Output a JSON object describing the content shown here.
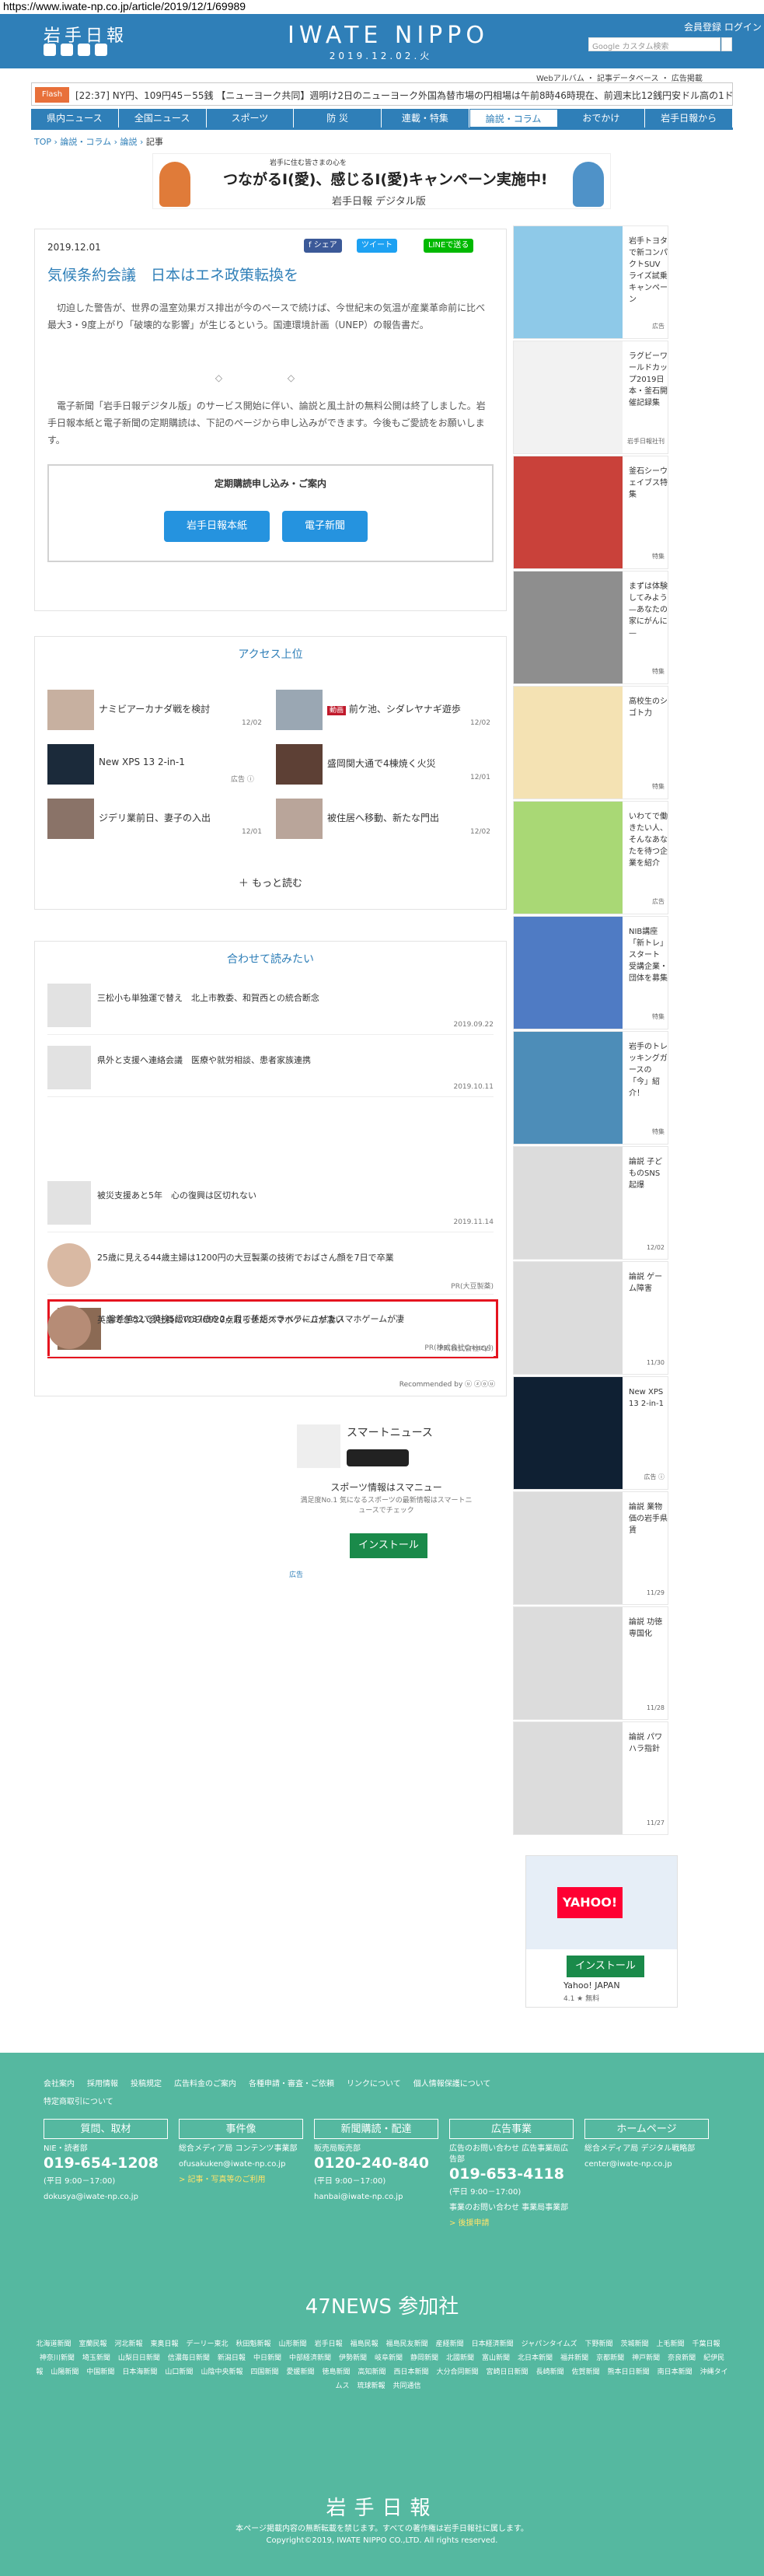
{
  "url": "https://www.iwate-np.co.jp/article/2019/12/1/69989",
  "header": {
    "logo": "岩手日報",
    "brand": "IWATE NIPPO",
    "date": "2019.12.02.火",
    "links": "会員登録 ログイン",
    "search_placeholder": "Google カスタム検索",
    "sub_links": "Webアルバム ・ 記事データベース ・ 広告掲載"
  },
  "flash": {
    "label": "Flash",
    "text": "[22:37] NY円、109円45－55銭 【ニューヨーク共同】週明け2日のニューヨーク外国為替市場の円相場は午前8時46時現在、前週末比12銭円安ドル高の1ドル"
  },
  "nav": [
    "県内ニュース",
    "全国ニュース",
    "スポーツ",
    "防 災",
    "連載・特集",
    "論説・コラム",
    "おでかけ",
    "岩手日報から"
  ],
  "breadcrumb": {
    "top": "TOP",
    "sep": " › ",
    "c1": "論説・コラム",
    "c2": "論説",
    "current": "記事"
  },
  "banner": {
    "t1": "岩手に住む皆さまの心を",
    "t2": "つながるⅠ(愛)、感じるⅠ(愛)キャンペーン実施中!",
    "t3": "岩手日報 デジタル版"
  },
  "article": {
    "date": "2019.12.01",
    "share_fb": "f シェア",
    "share_tw": "ツイート",
    "share_line": "LINEで送る",
    "title": "気候条約会議　日本はエネ政策転換を",
    "p1": "　切迫した警告が、世界の温室効果ガス排出が今のペースで続けば、今世紀末の気温が産業革命前に比べ最大3・9度上がり「破壊的な影響」が生じるという。国連環境計画（UNEP）の報告書だ。",
    "diamonds": "◇ ◇",
    "p2": "　電子新聞「岩手日報デジタル版」のサービス開始に伴い、論説と風土計の無料公開は終了しました。岩手日報本紙と電子新聞の定期購読は、下記のページから申し込みができます。今後もご愛読をお願いします。",
    "sub_title": "定期購読申し込み・ご案内",
    "btn_paper": "岩手日報本紙",
    "btn_digital": "電子新聞"
  },
  "ranking": {
    "title": "アクセス上位",
    "items": [
      {
        "title": "ナミビアーカナダ戦を検討",
        "date": "12/02"
      },
      {
        "title": "前ケ池、シダレヤナギ遊歩",
        "date": "12/02",
        "tag": "動画"
      },
      {
        "title": "New XPS 13 2-in-1",
        "date": "広告 ⓘ"
      },
      {
        "title": "盛岡関大通で4棟焼く火災",
        "date": "12/01"
      },
      {
        "title": "ジデリ業前日、妻子の入出",
        "date": "12/01"
      },
      {
        "title": "被住居へ移動、新たな門出",
        "date": "12/02"
      }
    ],
    "more": "＋ もっと読む"
  },
  "related": {
    "title": "合わせて読みたい",
    "items": [
      {
        "title": "三松小も単独運で替え　北上市教委、和賀西との統合断念",
        "date": "2019.09.22"
      },
      {
        "title": "県外と支援へ連絡会議　医療や就労相談、患者家族連携",
        "date": "2019.10.11"
      },
      {
        "title": "偏差値32で英検5級の37歳を2ヶ月で英語ペラペラにさせたスマホゲームが凄",
        "date": "PR(株式会社Creazy)"
      },
      {
        "title": "被災支援あと5年　心の復興は区切れない",
        "date": "2019.11.14"
      },
      {
        "title": "25歳に見える44歳主婦は1200円の大豆製薬の技術でおばさん顔を7日で卒業",
        "date": "PR(大豆製薬)"
      },
      {
        "title": "英語できない会社員にTOEIC920点取らせたスマホゲームが凄い",
        "date": "PR(株式会社IGS)"
      }
    ],
    "recommended": "Recommended by ⓤ ⓩⓞⓤ"
  },
  "ad_bottom": {
    "title": "スマートニュース",
    "sub": "スポーツ情報はスマニュー",
    "sub2": "満足度No.1 気になるスポーツの最新情報はスマートニュースでチェック",
    "install": "インストール",
    "label": "広告"
  },
  "side": [
    {
      "title": "岩手トヨタで新コンパクトSUVライズ試乗キャンペーン",
      "tag": "広告",
      "color": "#8ec9e8"
    },
    {
      "title": "ラグビーワールドカップ2019日本・釜石開催記録集",
      "tag": "岩手日報社刊",
      "color": "#f2f2f2"
    },
    {
      "title": "釜石シーウェイブス特集",
      "tag": "特集",
      "color": "#c9413a"
    },
    {
      "title": "まずは体験してみよう—あなたの家にがんに—",
      "tag": "特集",
      "color": "#8e8e8e"
    },
    {
      "title": "高校生のシゴト力",
      "tag": "特集",
      "color": "#f4e2b3"
    },
    {
      "title": "いわてで働きたい人、そんなあなたを待つ企業を紹介",
      "tag": "広告",
      "color": "#a9d875"
    },
    {
      "title": "NIB講座「新トレ」スタート　受講企業・団体を募集",
      "tag": "特集",
      "color": "#4f7bc4"
    },
    {
      "title": "岩手のトレッキングガースの「今」紹介！",
      "tag": "特集",
      "color": "#4d8db8"
    },
    {
      "title": "論説 子どものSNS起爆",
      "tag": "12/02",
      "color": "#dcdcdc"
    },
    {
      "title": "論説 ゲーム障害",
      "tag": "11/30",
      "color": "#dcdcdc"
    },
    {
      "title": "New XPS 13 2-in-1",
      "tag": "広告 ⓘ",
      "color": "#0f2033"
    },
    {
      "title": "論説 業物価の岩手県賃",
      "tag": "11/29",
      "color": "#dcdcdc"
    },
    {
      "title": "論説 功徳専国化",
      "tag": "11/28",
      "color": "#dcdcdc"
    },
    {
      "title": "論説 パワハラ指針",
      "tag": "11/27",
      "color": "#dcdcdc"
    }
  ],
  "side_ad": {
    "title": "Yahoo! JAPAN",
    "install": "インストール",
    "rating": "4.1 ★ 無料"
  },
  "footer": {
    "links": [
      "会社案内",
      "採用情報",
      "投稿規定",
      "広告料金のご案内",
      "各種申請・審査・ご依頼",
      "リンクについて",
      "個人情報保護について",
      "特定商取引について"
    ],
    "cols": [
      {
        "h": "質問、取材",
        "c1": "NIE・読者部",
        "tel": "019-654-1208",
        "c2": "(平日 9:00－17:00)",
        "mail": "dokusya@iwate-np.co.jp"
      },
      {
        "h": "事件像",
        "c1": "総合メディア局 コンテンツ事業部",
        "tel": "",
        "c2": "",
        "mail": "ofusakuken@iwate-np.co.jp",
        "link": "> 記事・写真等のご利用"
      },
      {
        "h": "新聞購読・配達",
        "c1": "販売局販売部",
        "tel": "0120-240-840",
        "c2": "(平日 9:00－17:00)",
        "mail": "hanbai@iwate-np.co.jp"
      },
      {
        "h": "広告事業",
        "c1": "広告のお問い合わせ 広告事業局広告部",
        "tel": "019-653-4118",
        "c2": "(平日 9:00－17:00)",
        "mail": "事業のお問い合わせ 事業局事業部",
        "link": "> 後援申請"
      },
      {
        "h": "ホームページ",
        "c1": "総合メディア局 デジタル戦略部",
        "tel": "",
        "c2": "",
        "mail": "center@iwate-np.co.jp"
      }
    ],
    "title47": "47NEWS 参加社",
    "papers": [
      "北海道新聞",
      "室蘭民報",
      "河北新報",
      "東奥日報",
      "デーリー東北",
      "秋田魁新報",
      "山形新聞",
      "岩手日報",
      "福島民報",
      "福島民友新聞",
      "産経新聞",
      "日本経済新聞",
      "ジャパンタイムズ",
      "下野新聞",
      "茨城新聞",
      "上毛新聞",
      "千葉日報",
      "神奈川新聞",
      "埼玉新聞",
      "山梨日日新聞",
      "信濃毎日新聞",
      "新潟日報",
      "中日新聞",
      "中部経済新聞",
      "伊勢新聞",
      "岐阜新聞",
      "静岡新聞",
      "北國新聞",
      "富山新聞",
      "北日本新聞",
      "福井新聞",
      "京都新聞",
      "神戸新聞",
      "奈良新聞",
      "紀伊民報",
      "山陽新聞",
      "中国新聞",
      "日本海新聞",
      "山口新聞",
      "山陰中央新報",
      "四国新聞",
      "愛媛新聞",
      "徳島新聞",
      "高知新聞",
      "西日本新聞",
      "大分合同新聞",
      "宮崎日日新聞",
      "長崎新聞",
      "佐賀新聞",
      "熊本日日新聞",
      "南日本新聞",
      "沖縄タイムス",
      "琉球新報",
      "共同通信"
    ],
    "logo": "岩手日報",
    "copy1": "本ページ掲載内容の無断転載を禁じます。すべての著作権は岩手日報社に属します。",
    "copy2": "Copyright©2019, IWATE NIPPO CO.,LTD. All rights reserved."
  }
}
